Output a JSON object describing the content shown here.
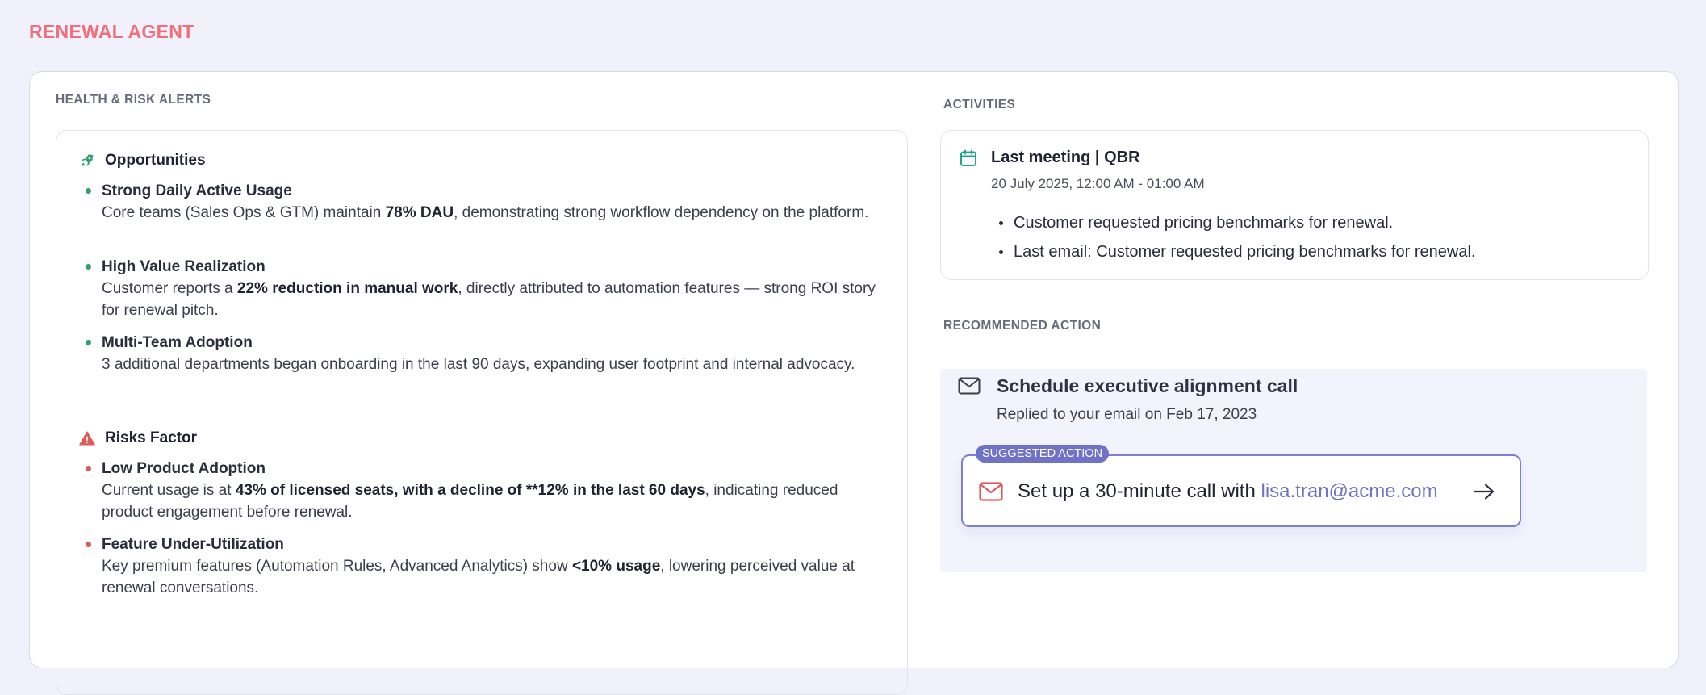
{
  "app": {
    "title": "RENEWAL AGENT"
  },
  "health": {
    "label": "HEALTH & RISK ALERTS",
    "opportunities": {
      "heading": "Opportunities",
      "items": [
        {
          "title": "Strong Daily Active Usage",
          "desc_pre": "Core teams (Sales Ops & GTM) maintain ",
          "desc_bold": "78% DAU",
          "desc_post": ", demonstrating strong workflow dependency on the platform."
        },
        {
          "title": "High Value Realization",
          "desc_pre": "Customer reports a ",
          "desc_bold": "22% reduction in manual work",
          "desc_post": ", directly attributed to automation features — strong ROI story for renewal pitch."
        },
        {
          "title": "Multi-Team Adoption",
          "desc_pre": "3 additional departments began onboarding in the last 90 days, expanding user footprint and internal advocacy.",
          "desc_bold": "",
          "desc_post": ""
        }
      ]
    },
    "risks": {
      "heading": "Risks Factor",
      "items": [
        {
          "title": "Low Product Adoption",
          "desc_pre": "Current usage is at ",
          "desc_bold": "43% of licensed seats, with a decline of **12% in the last 60 days",
          "desc_post": ", indicating reduced product engagement before renewal."
        },
        {
          "title": "Feature Under-Utilization",
          "desc_pre": "Key premium features (Automation Rules, Advanced Analytics) show ",
          "desc_bold": "<10% usage",
          "desc_post": ", lowering perceived value at renewal conversations."
        }
      ]
    }
  },
  "activities": {
    "label": "ACTIVITIES",
    "meeting_title": "Last meeting | QBR",
    "meeting_time": "20 July 2025, 12:00 AM - 01:00 AM",
    "notes": [
      "Customer requested pricing benchmarks for renewal.",
      "Last email: Customer requested pricing benchmarks for renewal."
    ]
  },
  "recommended": {
    "label": "RECOMMENDED ACTION",
    "title": "Schedule executive alignment call",
    "subtitle": "Replied to your email on Feb 17, 2023",
    "badge": "SUGGESTED ACTION",
    "action_text": "Set up a 30-minute call with ",
    "action_email": "lisa.tran@acme.com"
  },
  "colors": {
    "brand": "#ef6f7a",
    "accent": "#6f73c8",
    "opportunity": "#2fa36b",
    "risk": "#e05a5a",
    "calendar": "#1fa58f"
  },
  "icons": {
    "opportunities": "rocket-icon",
    "risks": "warning-icon",
    "meeting": "calendar-icon",
    "recommended": "mail-icon",
    "suggest": "mail-icon",
    "suggest_go": "arrow-right-icon"
  }
}
